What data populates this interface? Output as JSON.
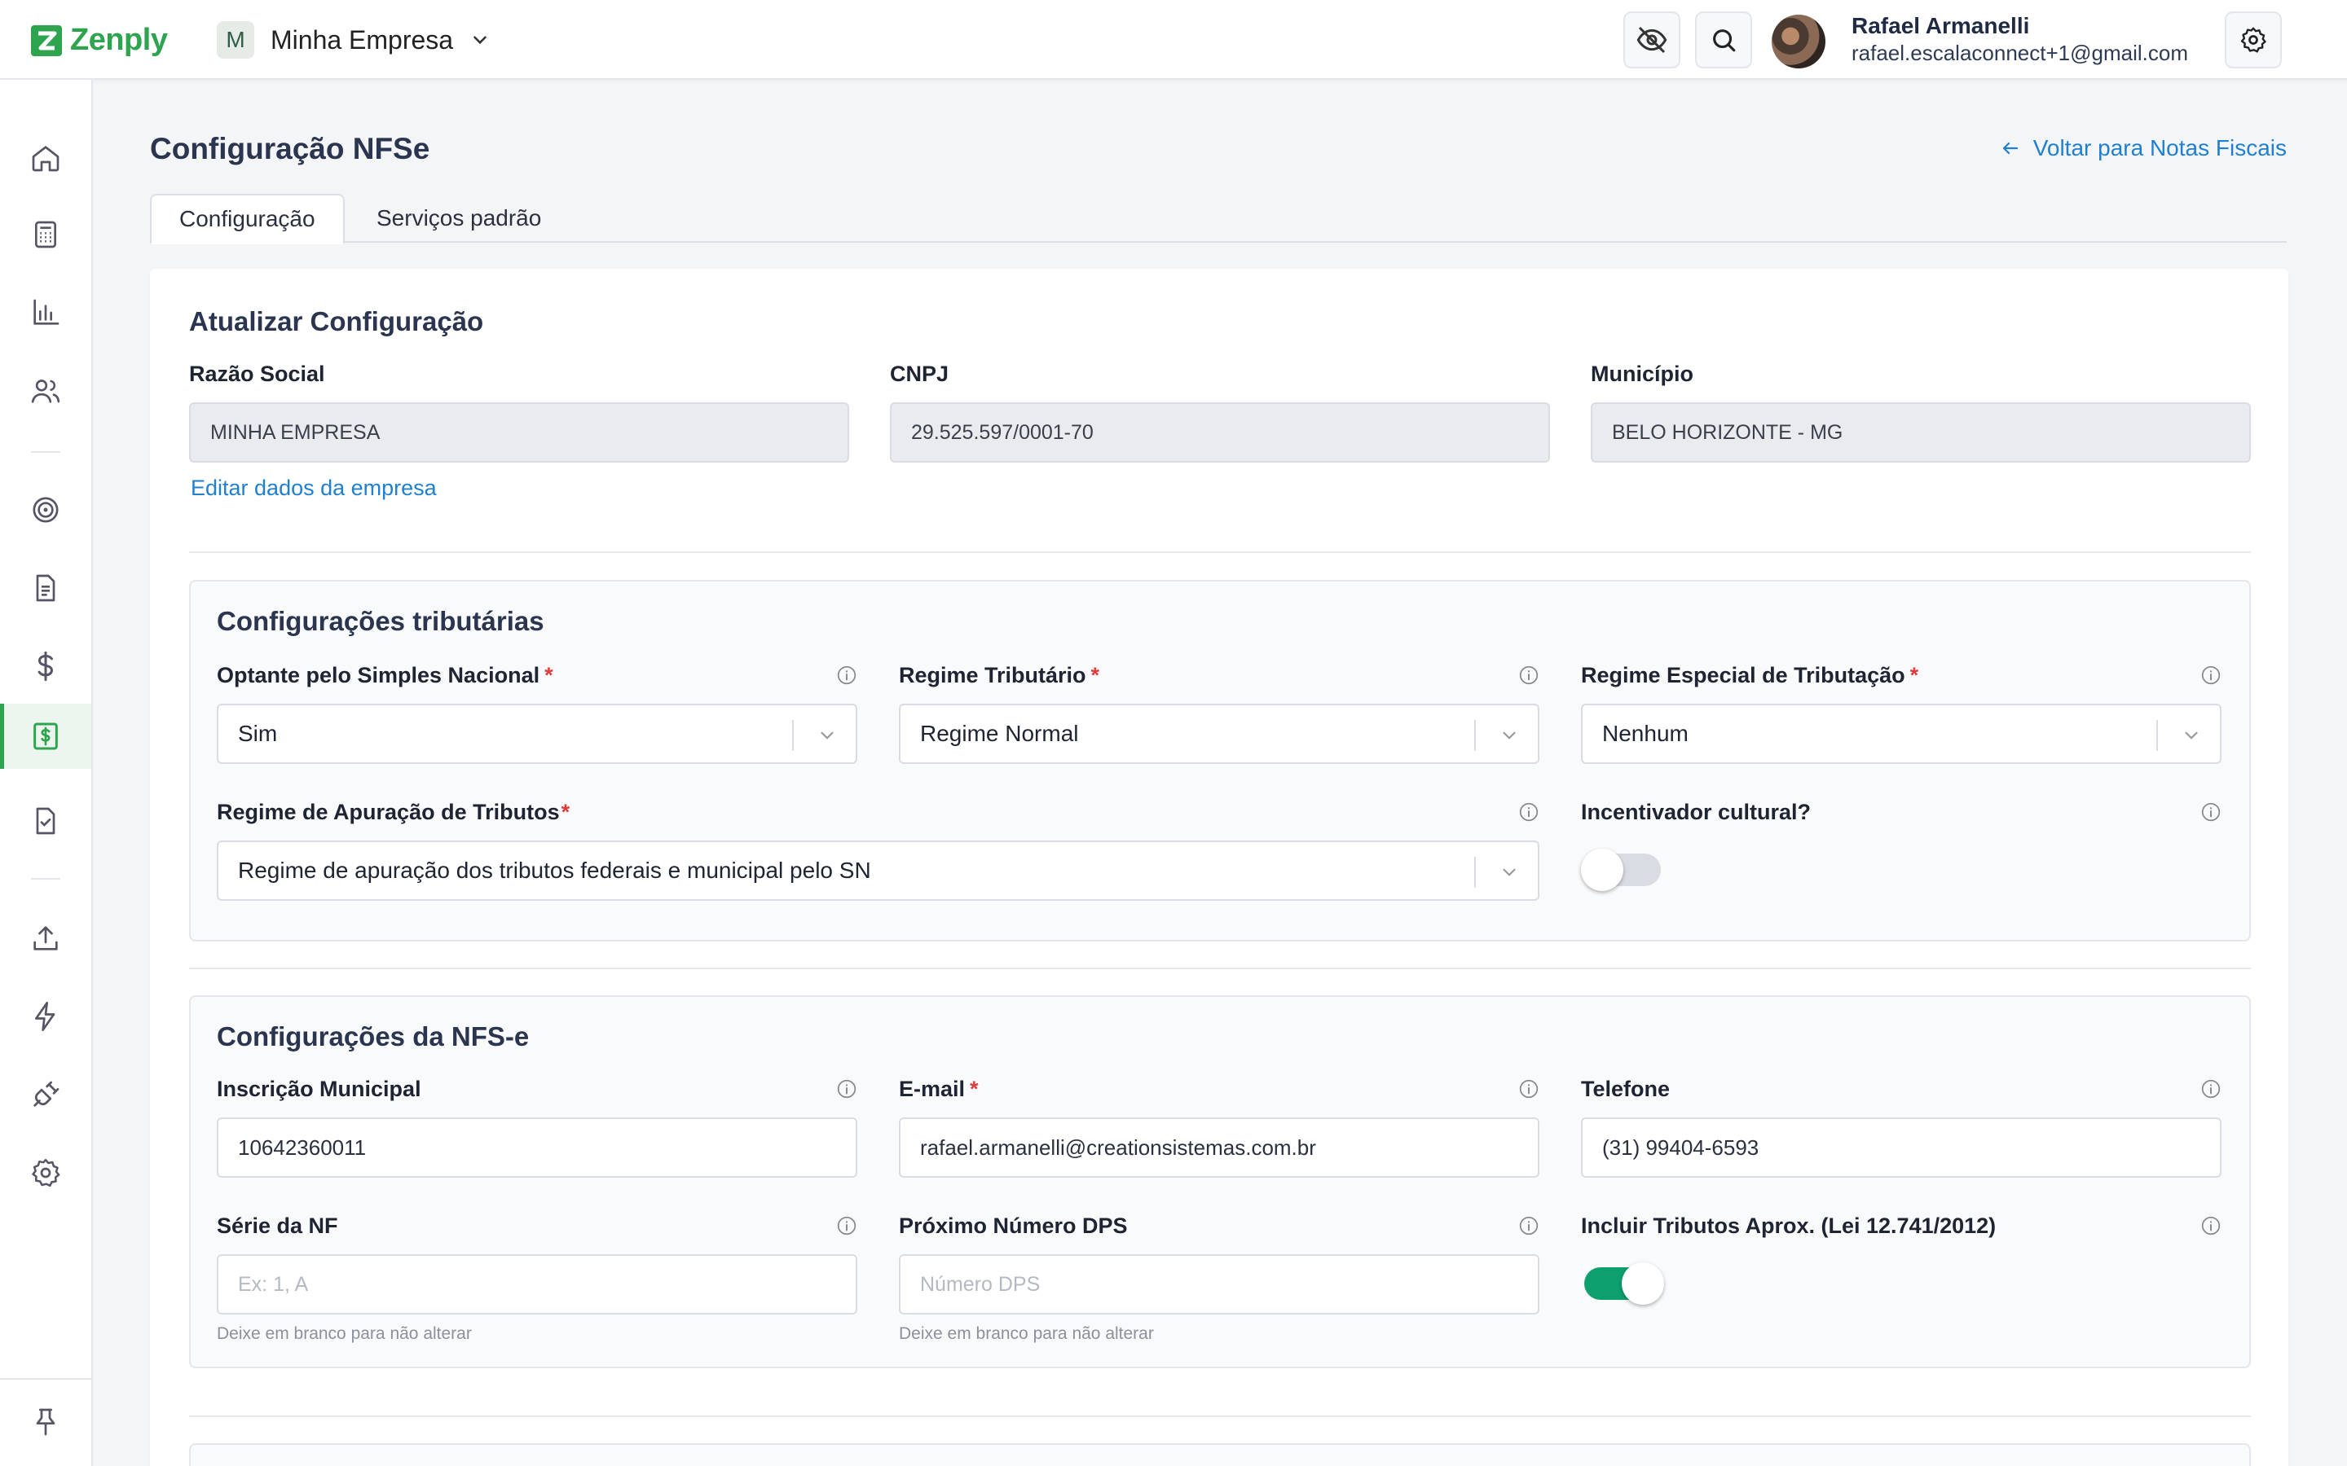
{
  "brand": {
    "name": "Zenply",
    "color": "#2ea44f"
  },
  "company": {
    "initial": "M",
    "name": "Minha Empresa"
  },
  "user": {
    "name": "Rafael Armanelli",
    "email": "rafael.escalaconnect+1@gmail.com"
  },
  "header_icons": [
    "eye-off-icon",
    "search-icon",
    "settings-icon"
  ],
  "sidebar": {
    "items": [
      {
        "icon": "home-icon"
      },
      {
        "icon": "calculator-icon"
      },
      {
        "icon": "bar-chart-icon"
      },
      {
        "icon": "users-icon"
      },
      {
        "icon": "target-icon"
      },
      {
        "icon": "document-icon"
      },
      {
        "icon": "dollar-icon"
      },
      {
        "icon": "invoice-dollar-icon",
        "active": true
      },
      {
        "icon": "document-check-icon"
      },
      {
        "icon": "upload-icon"
      },
      {
        "icon": "lightning-icon"
      },
      {
        "icon": "plug-icon"
      },
      {
        "icon": "gear-icon"
      },
      {
        "icon": "pin-icon"
      }
    ]
  },
  "page": {
    "title": "Configuração NFSe",
    "back_link": "Voltar para Notas Fiscais",
    "tabs": [
      {
        "label": "Configuração",
        "active": true
      },
      {
        "label": "Serviços padrão"
      }
    ]
  },
  "update_config": {
    "title": "Atualizar Configuração",
    "razao_social": {
      "label": "Razão Social",
      "value": "MINHA EMPRESA"
    },
    "cnpj": {
      "label": "CNPJ",
      "value": "29.525.597/0001-70"
    },
    "municipio": {
      "label": "Município",
      "value": "BELO HORIZONTE - MG"
    },
    "edit_link": "Editar dados da empresa"
  },
  "tributarias": {
    "title": "Configurações tributárias",
    "simples": {
      "label": "Optante pelo Simples Nacional",
      "required": "*",
      "value": "Sim"
    },
    "regime": {
      "label": "Regime Tributário",
      "required": "*",
      "value": "Regime Normal"
    },
    "regime_especial": {
      "label": "Regime Especial de Tributação",
      "required": "*",
      "value": "Nenhum"
    },
    "apuracao": {
      "label": "Regime de Apuração de Tributos",
      "required": "*",
      "value": "Regime de apuração dos tributos federais e municipal pelo SN"
    },
    "incentivador": {
      "label": "Incentivador cultural?",
      "enabled": false
    }
  },
  "nfse": {
    "title": "Configurações da NFS-e",
    "inscricao": {
      "label": "Inscrição Municipal",
      "value": "10642360011"
    },
    "email": {
      "label": "E-mail",
      "required": "*",
      "value": "rafael.armanelli@creationsistemas.com.br"
    },
    "telefone": {
      "label": "Telefone",
      "value": "(31) 99404-6593"
    },
    "serie": {
      "label": "Série da NF",
      "placeholder": "Ex: 1, A",
      "hint": "Deixe em branco para não alterar"
    },
    "proximo_dps": {
      "label": "Próximo Número DPS",
      "placeholder": "Número DPS",
      "hint": "Deixe em branco para não alterar"
    },
    "incluir_tributos": {
      "label": "Incluir Tributos Aprox. (Lei 12.741/2012)",
      "enabled": true
    }
  }
}
